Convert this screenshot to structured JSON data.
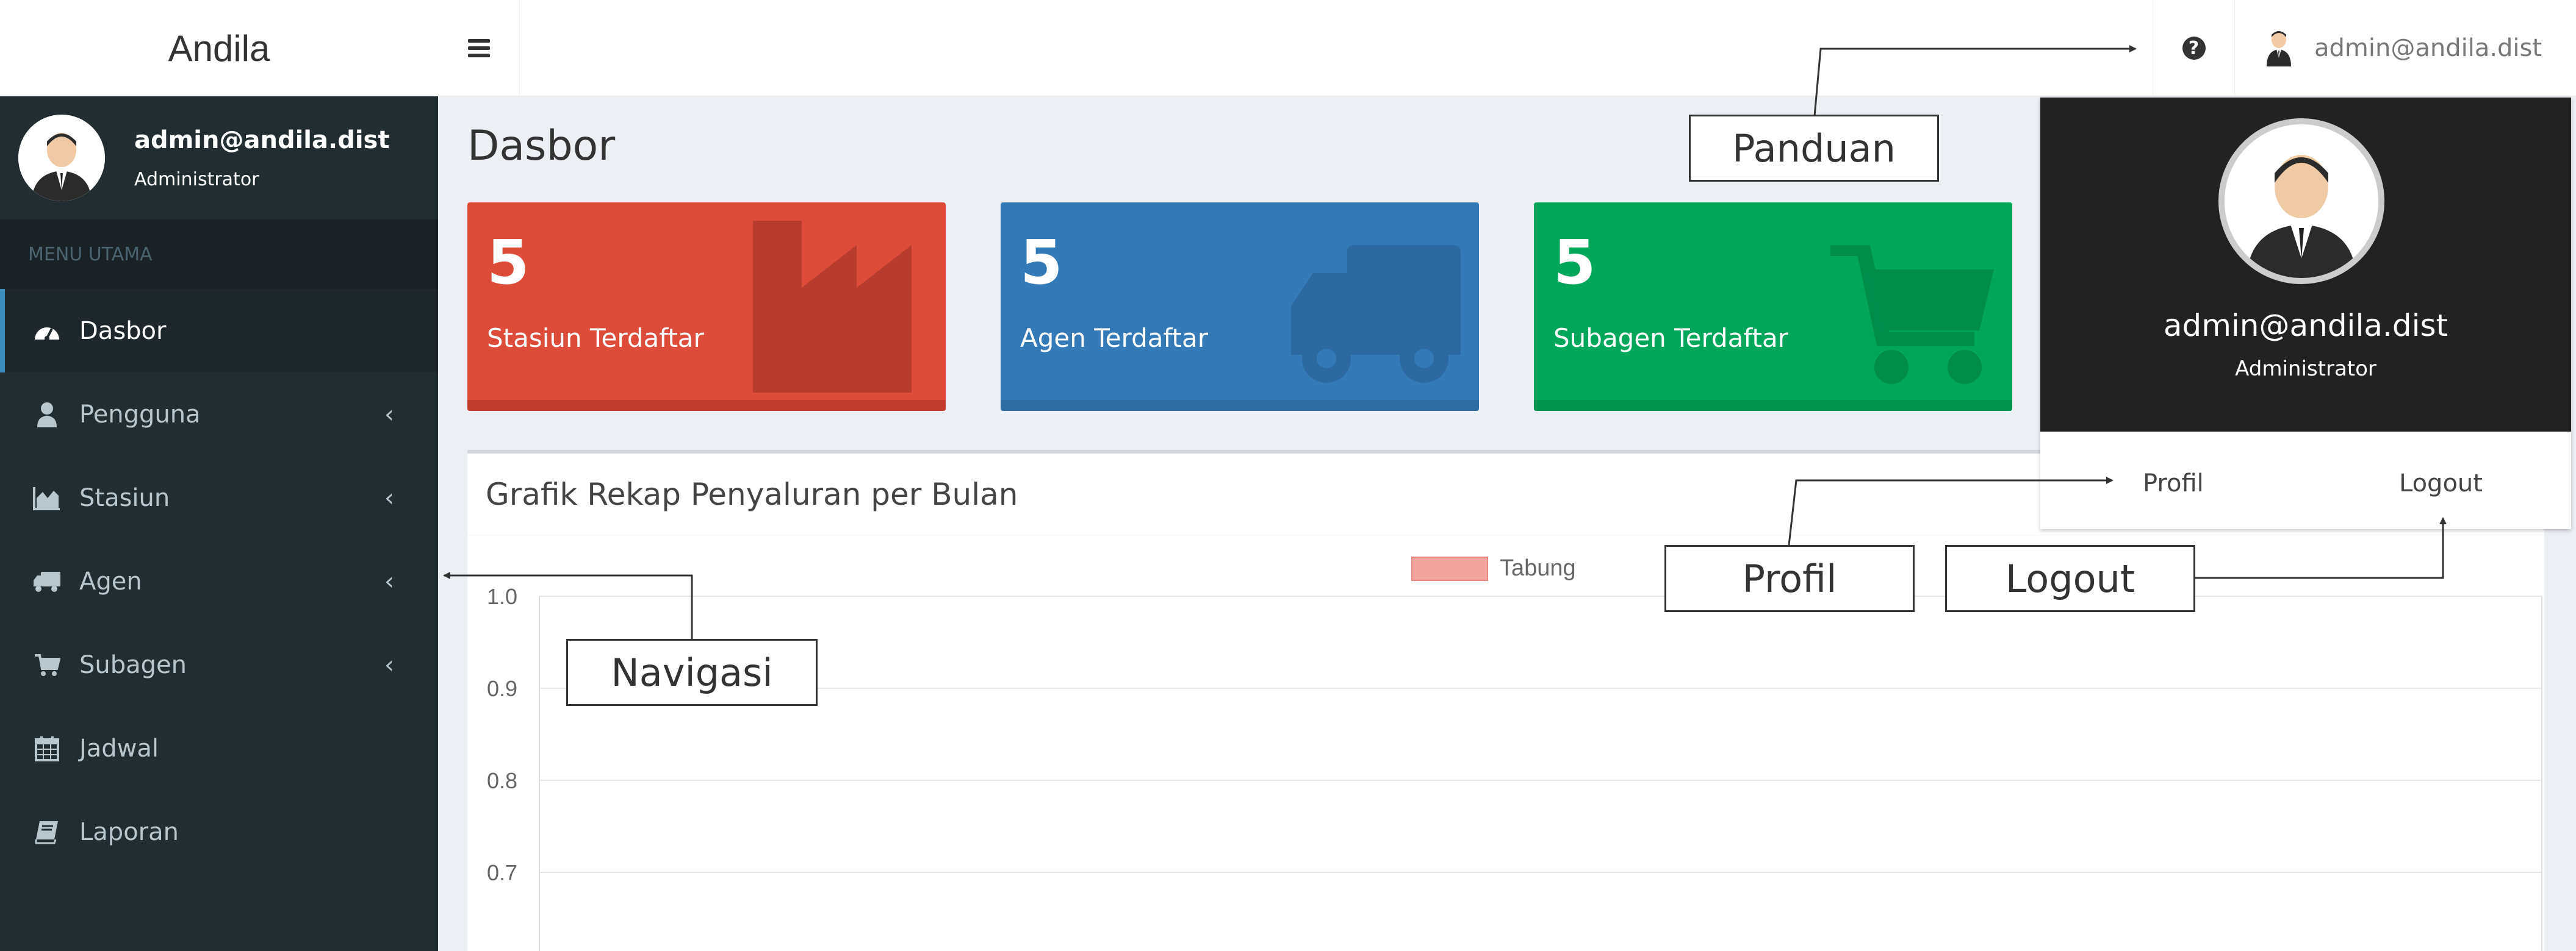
{
  "app": {
    "brand": "Andila"
  },
  "header": {
    "user_email": "admin@andila.dist"
  },
  "sidebar": {
    "user_email": "admin@andila.dist",
    "user_role": "Administrator",
    "menu_header": "MENU UTAMA",
    "items": [
      {
        "label": "Dasbor",
        "icon": "dashboard-icon"
      },
      {
        "label": "Pengguna",
        "icon": "user-icon"
      },
      {
        "label": "Stasiun",
        "icon": "area-chart-icon"
      },
      {
        "label": "Agen",
        "icon": "truck-icon"
      },
      {
        "label": "Subagen",
        "icon": "cart-icon"
      },
      {
        "label": "Jadwal",
        "icon": "calendar-icon"
      },
      {
        "label": "Laporan",
        "icon": "book-icon"
      }
    ]
  },
  "page": {
    "title": "Dasbor"
  },
  "stat_boxes": [
    {
      "value": "5",
      "label": "Stasiun Terdaftar",
      "color": "#dd4b39",
      "icon": "industry-icon"
    },
    {
      "value": "5",
      "label": "Agen Terdaftar",
      "color": "#337ab7",
      "icon": "truck-icon"
    },
    {
      "value": "5",
      "label": "Subagen Terdaftar",
      "color": "#00a65a",
      "icon": "cart-icon"
    }
  ],
  "chart": {
    "title": "Grafik Rekap Penyaluran per Bulan",
    "legend": "Tabung",
    "y_ticks": [
      "1.0",
      "0.9",
      "0.8",
      "0.7"
    ]
  },
  "chart_data": {
    "type": "bar",
    "title": "Grafik Rekap Penyaluran per Bulan",
    "series": [
      {
        "name": "Tabung",
        "values": [],
        "color": "#f2a59c"
      }
    ],
    "y_ticks": [
      1.0,
      0.9,
      0.8,
      0.7
    ],
    "legend": "top"
  },
  "dropdown": {
    "user_email": "admin@andila.dist",
    "user_role": "Administrator",
    "profile_label": "Profil",
    "logout_label": "Logout"
  },
  "callouts": {
    "panduan": "Panduan",
    "navigasi": "Navigasi",
    "profil": "Profil",
    "logout": "Logout"
  }
}
